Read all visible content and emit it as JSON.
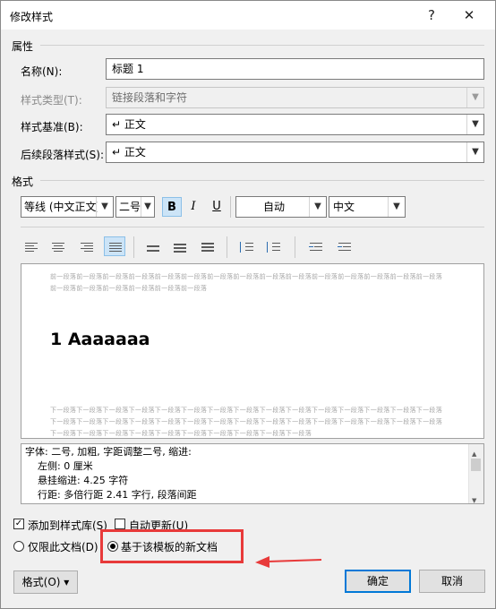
{
  "window": {
    "title": "修改样式",
    "help": "?",
    "close": "✕"
  },
  "properties": {
    "section_label": "属性",
    "name_label": "名称(N):",
    "name_value": "标题 1",
    "style_type_label": "样式类型(T):",
    "style_type_value": "链接段落和字符",
    "based_on_label": "样式基准(B):",
    "based_on_value": "↵ 正文",
    "next_style_label": "后续段落样式(S):",
    "next_style_value": "↵ 正文"
  },
  "format": {
    "section_label": "格式",
    "font": "等线 (中文正文)",
    "size": "二号",
    "bold": "B",
    "italic": "I",
    "underline": "U",
    "color": "自动",
    "script": "中文"
  },
  "preview": {
    "before_text": "前一段落前一段落前一段落前一段落前一段落前一段落前一段落前一段落前一段落前一段落前一段落前一段落前一段落前一段落前一段落前一段落前一段落前一段落前一段落前一段落前一段落",
    "heading_text": "1  Aaaaaaa",
    "after_text": "下一段落下一段落下一段落下一段落下一段落下一段落下一段落下一段落下一段落下一段落下一段落下一段落下一段落下一段落下一段落下一段落下一段落下一段落下一段落下一段落下一段落下一段落下一段落下一段落下一段落下一段落下一段落下一段落下一段落下一段落下一段落下一段落下一段落下一段落下一段落下一段落下一段落下一段落下一段落下一段落"
  },
  "description": {
    "line1": "字体: 二号, 加粗, 字距调整二号, 缩进:",
    "line2": "左侧:  0 厘米",
    "line3": "悬挂缩进: 4.25 字符",
    "line4": "行距: 多倍行距 2.41 字行, 段落间距"
  },
  "options": {
    "add_to_gallery": "添加到样式库(S)",
    "auto_update": "自动更新(U)",
    "only_this_doc": "仅限此文档(D)",
    "new_docs_template": "基于该模板的新文档"
  },
  "buttons": {
    "format_menu": "格式(O) ▾",
    "ok": "确定",
    "cancel": "取消"
  },
  "colors": {
    "highlight": "#e83a3a",
    "accent": "#0078d7"
  }
}
